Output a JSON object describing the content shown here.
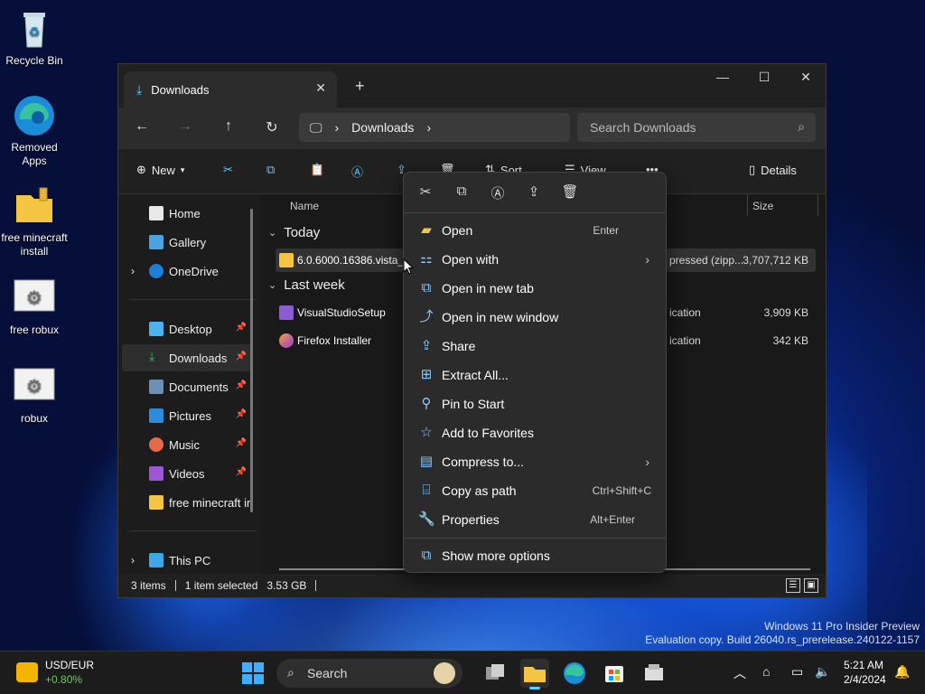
{
  "desktop": {
    "icons": [
      {
        "label": "Recycle Bin"
      },
      {
        "label": "Removed Apps"
      },
      {
        "label": "free minecraft install"
      },
      {
        "label": "free robux"
      },
      {
        "label": "robux"
      }
    ]
  },
  "window": {
    "tab_title": "Downloads",
    "new_tab": "+",
    "minimize": "—",
    "maximize": "☐",
    "close": "✕",
    "breadcrumb": "Downloads",
    "search_placeholder": "Search Downloads",
    "toolbar": {
      "new_label": "New",
      "sort_label": "Sort",
      "view_label": "View",
      "more_label": "•••",
      "details_label": "Details"
    }
  },
  "sidebar": {
    "items": [
      {
        "label": "Home"
      },
      {
        "label": "Gallery"
      },
      {
        "label": "OneDrive"
      },
      {
        "label": "Desktop"
      },
      {
        "label": "Downloads"
      },
      {
        "label": "Documents"
      },
      {
        "label": "Pictures"
      },
      {
        "label": "Music"
      },
      {
        "label": "Videos"
      },
      {
        "label": "free minecraft ir"
      },
      {
        "label": "This PC"
      }
    ]
  },
  "filelist": {
    "columns": {
      "name": "Name",
      "size": "Size"
    },
    "groups": [
      {
        "label": "Today"
      },
      {
        "label": "Last week"
      }
    ],
    "rows": [
      {
        "name": "6.0.6000.16386.vista_rtr",
        "type": "pressed (zipp...",
        "size": "3,707,712 KB"
      },
      {
        "name": "VisualStudioSetup",
        "type": "ication",
        "size": "3,909 KB"
      },
      {
        "name": "Firefox Installer",
        "type": "ication",
        "size": "342 KB"
      }
    ]
  },
  "status": {
    "count": "3 items",
    "selected": "1 item selected",
    "size": "3.53 GB"
  },
  "context_menu": {
    "quick": [
      "cut",
      "copy",
      "rename",
      "share",
      "delete"
    ],
    "items": [
      {
        "label": "Open",
        "shortcut": "Enter",
        "icon": "folder-icon"
      },
      {
        "label": "Open with",
        "shortcut": "",
        "icon": "open-with-icon"
      },
      {
        "label": "Open in new tab",
        "shortcut": "",
        "icon": "new-tab-icon"
      },
      {
        "label": "Open in new window",
        "shortcut": "",
        "icon": "new-window-icon"
      },
      {
        "label": "Share",
        "shortcut": "",
        "icon": "share-icon"
      },
      {
        "label": "Extract All...",
        "shortcut": "",
        "icon": "extract-icon"
      },
      {
        "label": "Pin to Start",
        "shortcut": "",
        "icon": "pin-icon"
      },
      {
        "label": "Add to Favorites",
        "shortcut": "",
        "icon": "star-icon"
      },
      {
        "label": "Compress to...",
        "shortcut": "",
        "icon": "compress-icon"
      },
      {
        "label": "Copy as path",
        "shortcut": "Ctrl+Shift+C",
        "icon": "copy-path-icon"
      },
      {
        "label": "Properties",
        "shortcut": "Alt+Enter",
        "icon": "wrench-icon"
      },
      {
        "label": "Show more options",
        "shortcut": "",
        "icon": "more-options-icon"
      }
    ]
  },
  "watermark": {
    "line1": "Windows 11 Pro Insider Preview",
    "line2": "Evaluation copy. Build 26040.rs_prerelease.240122-1157"
  },
  "taskbar": {
    "widget_title": "USD/EUR",
    "widget_value": "+0.80%",
    "search_label": "Search",
    "time": "5:21 AM",
    "date": "2/4/2024"
  },
  "colors": {
    "accent": "#60cdff",
    "positive": "#6ccb5f"
  }
}
